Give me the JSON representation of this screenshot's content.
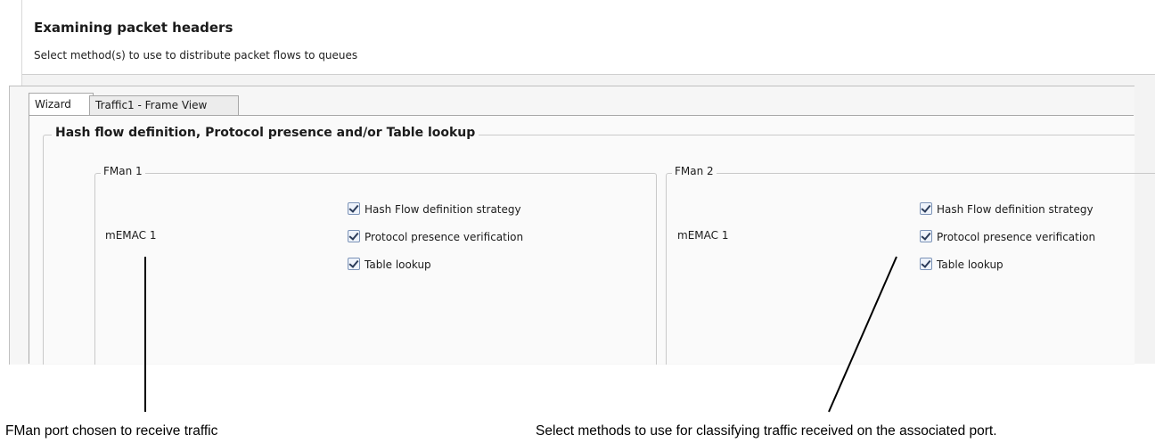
{
  "header": {
    "title": "Examining packet headers",
    "subtitle": "Select method(s) to use to distribute packet flows to queues"
  },
  "tabs": [
    {
      "label": "Wizard",
      "active": true
    },
    {
      "label": "Traffic1 - Frame View",
      "active": false
    }
  ],
  "group": {
    "title": "Hash flow definition, Protocol presence and/or Table lookup"
  },
  "fmans": [
    {
      "title": "FMan 1",
      "port": "mEMAC 1",
      "options": [
        {
          "label": "Hash Flow definition strategy",
          "checked": true
        },
        {
          "label": "Protocol presence verification",
          "checked": true
        },
        {
          "label": "Table lookup",
          "checked": true
        }
      ]
    },
    {
      "title": "FMan 2",
      "port": "mEMAC 1",
      "options": [
        {
          "label": "Hash Flow definition strategy",
          "checked": true
        },
        {
          "label": "Protocol presence verification",
          "checked": true
        },
        {
          "label": "Table lookup",
          "checked": true
        }
      ]
    }
  ],
  "annotations": {
    "port_note": "FMan port chosen to receive traffic",
    "methods_note": "Select methods to use for classifying traffic received on the associated port."
  },
  "colors": {
    "panel_bg": "#f3f3f3",
    "border": "#c9c9c9",
    "checkbox_border": "#7c93b7"
  }
}
